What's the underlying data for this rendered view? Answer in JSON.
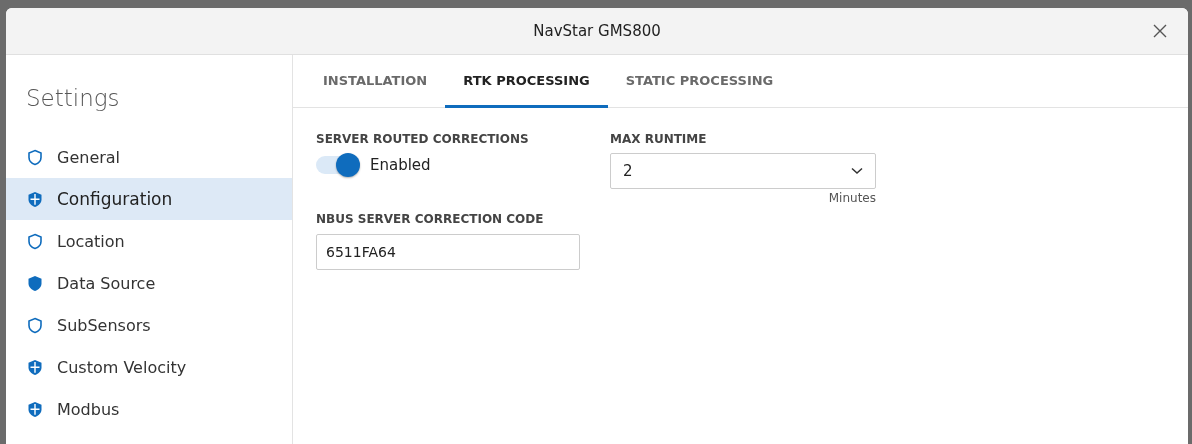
{
  "window": {
    "title": "NavStar GMS800"
  },
  "sidebar": {
    "title": "Settings",
    "items": [
      {
        "label": "General",
        "kind": "outline",
        "selected": false
      },
      {
        "label": "Configuration",
        "kind": "split",
        "selected": true
      },
      {
        "label": "Location",
        "kind": "outline",
        "selected": false
      },
      {
        "label": "Data Source",
        "kind": "solid",
        "selected": false
      },
      {
        "label": "SubSensors",
        "kind": "outline",
        "selected": false
      },
      {
        "label": "Custom Velocity",
        "kind": "split",
        "selected": false
      },
      {
        "label": "Modbus",
        "kind": "split",
        "selected": false
      }
    ]
  },
  "tabs": [
    {
      "label": "INSTALLATION",
      "selected": false
    },
    {
      "label": "RTK PROCESSING",
      "selected": true
    },
    {
      "label": "STATIC PROCESSING",
      "selected": false
    }
  ],
  "form": {
    "server_routed_corrections": {
      "label": "SERVER ROUTED CORRECTIONS",
      "on": true,
      "text": "Enabled"
    },
    "max_runtime": {
      "label": "MAX RUNTIME",
      "value": "2",
      "unit": "Minutes"
    },
    "correction_code": {
      "label": "NBUS SERVER CORRECTION CODE",
      "value": "6511FA64"
    }
  }
}
